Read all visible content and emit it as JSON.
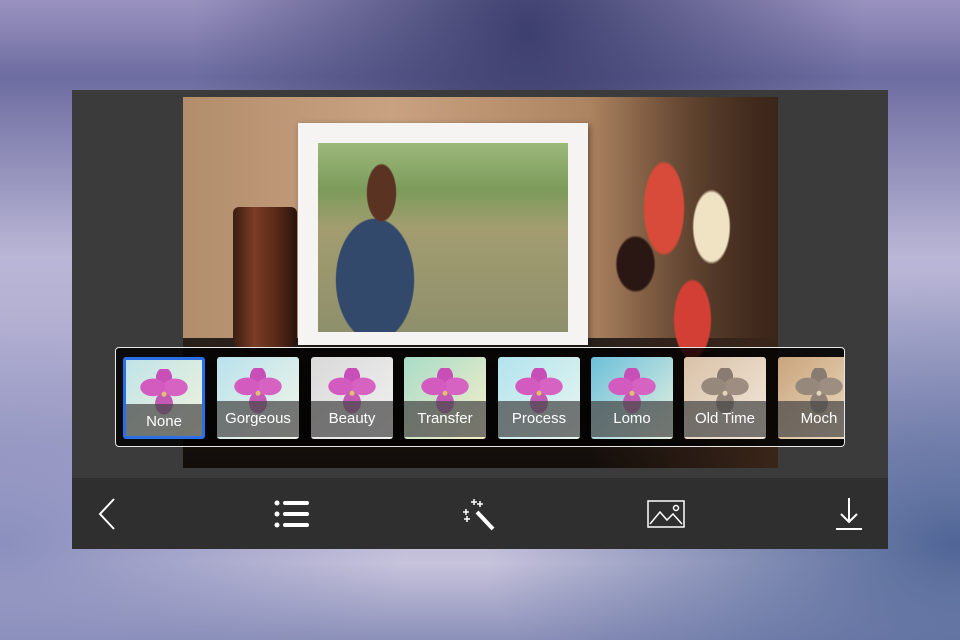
{
  "filters": [
    {
      "label": "None",
      "selected": true,
      "tint": "linear-gradient(135deg,#bfe4e8,#f3f3da)"
    },
    {
      "label": "Gorgeous",
      "selected": false,
      "tint": "linear-gradient(135deg,#b8e2ec,#f6f6e8)"
    },
    {
      "label": "Beauty",
      "selected": false,
      "tint": "linear-gradient(135deg,#d9d9d9,#f2f2f2)"
    },
    {
      "label": "Transfer",
      "selected": false,
      "tint": "linear-gradient(135deg,#a8dcc8,#f7efc8)"
    },
    {
      "label": "Process",
      "selected": false,
      "tint": "linear-gradient(135deg,#b2e4ee,#eaf6f0)"
    },
    {
      "label": "Lomo",
      "selected": false,
      "tint": "linear-gradient(135deg,#6cc0da,#e8f2e0)"
    },
    {
      "label": "Old Time",
      "selected": false,
      "tint": "linear-gradient(135deg,#d9c2a8,#f4e8dc)"
    },
    {
      "label": "Moch",
      "selected": false,
      "tint": "linear-gradient(135deg,#c9a57c,#f0e0c8)"
    }
  ],
  "toolbar": {
    "icons": [
      "back-chevron-icon",
      "list-icon",
      "magic-wand-icon",
      "image-icon",
      "download-icon"
    ]
  },
  "accent": "#2a6fe6"
}
